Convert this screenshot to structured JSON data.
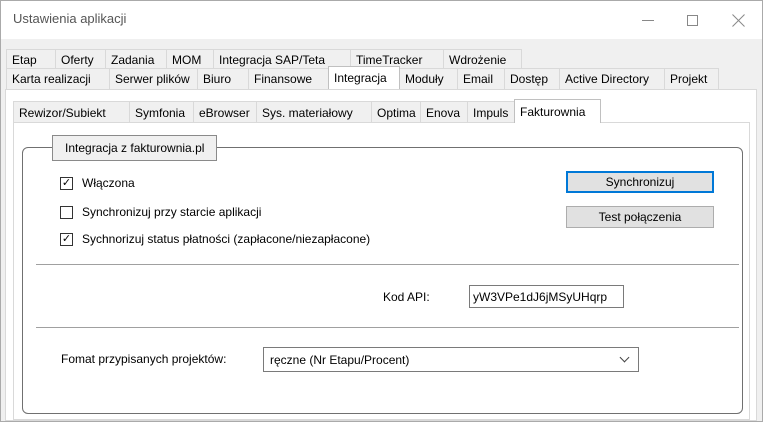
{
  "window": {
    "title": "Ustawienia aplikacji"
  },
  "tabs_row1": [
    "Etap",
    "Oferty",
    "Zadania",
    "MOM",
    "Integracja SAP/Teta",
    "TimeTracker",
    "Wdrożenie"
  ],
  "tabs_row2": [
    "Karta realizacji",
    "Serwer plików",
    "Biuro",
    "Finansowe",
    "Integracja",
    "Moduły",
    "Email",
    "Dostęp",
    "Active Directory",
    "Projekt"
  ],
  "active_tab": "Integracja",
  "subtabs": [
    "Rewizor/Subiekt",
    "Symfonia",
    "eBrowser",
    "Sys. materiałowy",
    "Optima",
    "Enova",
    "Impuls",
    "Fakturownia"
  ],
  "active_subtab": "Fakturownia",
  "group": {
    "title": "Integracja z fakturownia.pl",
    "checkboxes": [
      {
        "label": "Włączona",
        "checked": true
      },
      {
        "label": "Synchronizuj przy starcie aplikacji",
        "checked": false
      },
      {
        "label": "Sychnorizuj status płatności (zapłacone/niezapłacone)",
        "checked": true
      }
    ],
    "sync_button": "Synchronizuj",
    "test_button": "Test połączenia",
    "api_label": "Kod API:",
    "api_value": "yW3VPe1dJ6jMSyUHqrp",
    "format_label": "Fomat przypisanych projektów:",
    "format_value": "ręczne (Nr Etapu/Procent)"
  }
}
